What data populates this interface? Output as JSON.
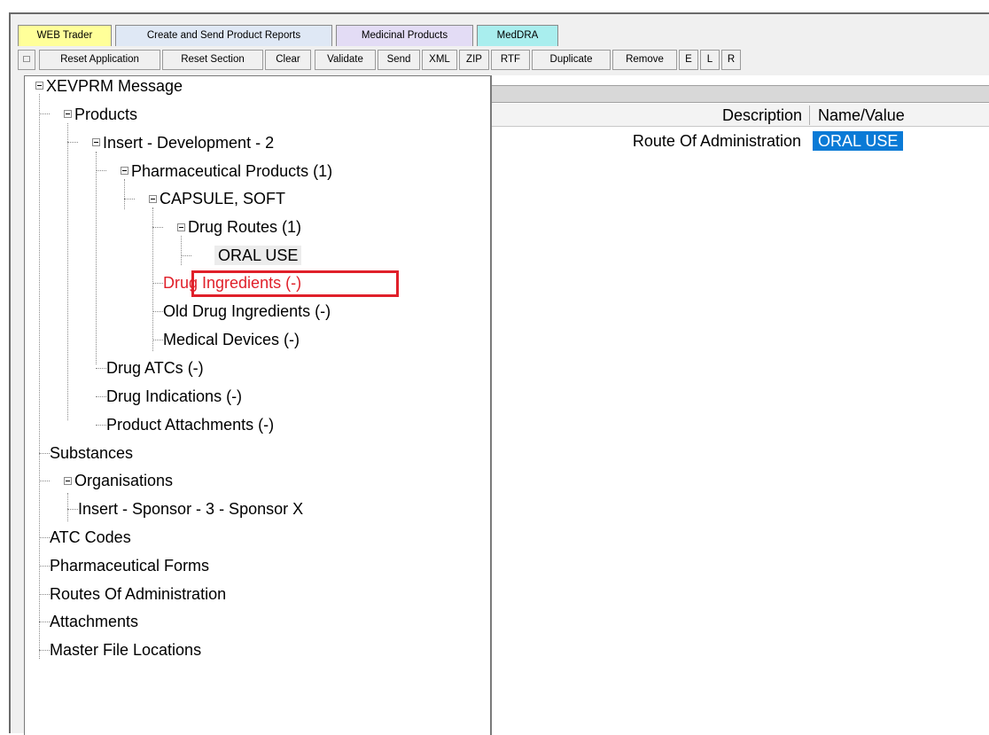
{
  "tabs": [
    {
      "label": "WEB Trader",
      "color": "#ffff99"
    },
    {
      "label": "Create and Send Product Reports",
      "color": "#dfe8f5"
    },
    {
      "label": "Medicinal Products",
      "color": "#e3dcf5"
    },
    {
      "label": "MedDRA",
      "color": "#a9eeee"
    }
  ],
  "toolbar": {
    "checkbox_label": "□",
    "buttons": [
      "Reset Application",
      "Reset Section",
      "Clear",
      "Validate",
      "Send",
      "XML",
      "ZIP",
      "RTF",
      "Duplicate",
      "Remove",
      "E",
      "L",
      "R"
    ]
  },
  "tree": {
    "root": "XEVPRM Message",
    "products": "Products",
    "insert_development": "Insert - Development - 2",
    "pharmaceutical_products": "Pharmaceutical Products (1)",
    "capsule_soft": "CAPSULE, SOFT",
    "drug_routes": "Drug Routes (1)",
    "oral_use": "ORAL USE",
    "drug_ingredients": "Drug Ingredients (-)",
    "old_drug_ingredients": "Old Drug Ingredients (-)",
    "medical_devices": "Medical Devices (-)",
    "drug_atcs": "Drug ATCs (-)",
    "drug_indications": "Drug Indications (-)",
    "product_attachments": "Product Attachments (-)",
    "substances": "Substances",
    "organisations": "Organisations",
    "insert_sponsor": "Insert - Sponsor - 3 - Sponsor X",
    "atc_codes": "ATC Codes",
    "pharmaceutical_forms": "Pharmaceutical Forms",
    "routes_of_administration": "Routes Of Administration",
    "attachments": "Attachments",
    "master_file_locations": "Master File Locations"
  },
  "grid": {
    "columns": [
      "Description",
      "Name/Value"
    ],
    "rows": [
      {
        "description": "Route Of Administration",
        "value": "ORAL USE"
      }
    ]
  },
  "colors": {
    "highlight_box": "#e0202a",
    "highlight_text": "#e0202a",
    "selected_value_bg": "#0a7ad6",
    "selected_value_text": "#ffffff"
  }
}
